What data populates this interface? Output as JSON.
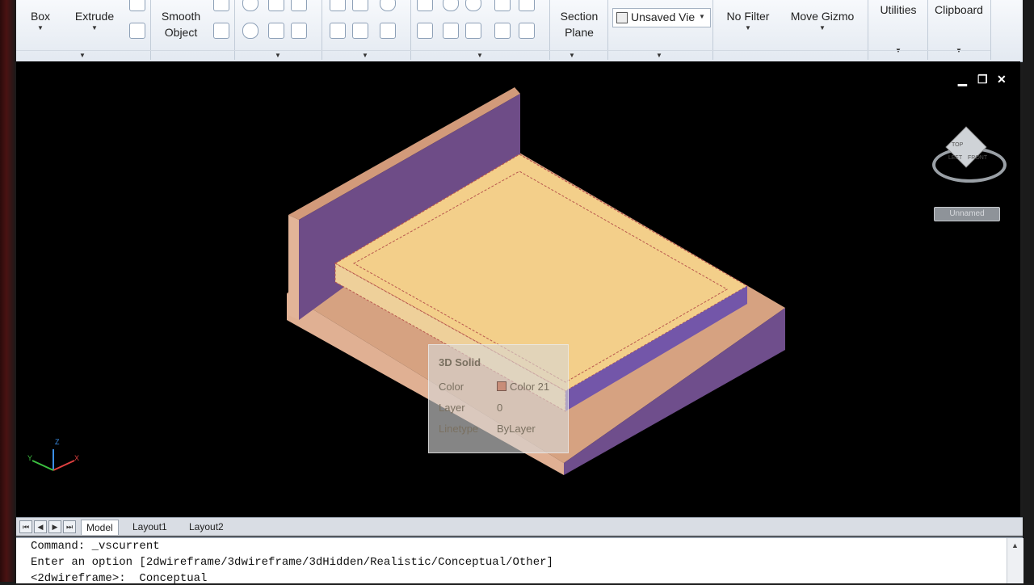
{
  "ribbon": {
    "box_label": "Box",
    "extrude_label": "Extrude",
    "smooth_object_label": "Smooth\nObject",
    "section_plane_label": "Section\nPlane",
    "view_select_value": "Unsaved Vie",
    "no_filter_label": "No Filter",
    "move_gizmo_label": "Move Gizmo",
    "utilities_label": "Utilities",
    "clipboard_label": "Clipboard"
  },
  "viewport": {
    "viewcube_faces": [
      "TOP",
      "LEFT",
      "FRONT"
    ],
    "view_name": "Unnamed",
    "axis_labels": {
      "x": "X",
      "y": "Y",
      "z": "Z"
    }
  },
  "tooltip": {
    "title": "3D Solid",
    "rows": [
      {
        "label": "Color",
        "value": "Color 21"
      },
      {
        "label": "Layer",
        "value": "0"
      },
      {
        "label": "Linetype",
        "value": "ByLayer"
      }
    ]
  },
  "tabs": [
    "Model",
    "Layout1",
    "Layout2"
  ],
  "command_lines": [
    "Command: _vscurrent",
    "Enter an option [2dwireframe/3dwireframe/3dHidden/Realistic/Conceptual/Other]",
    "<2dwireframe>:  Conceptual"
  ],
  "colors": {
    "headboard_face": "#6e4c87",
    "wood_top": "#d6a281",
    "mattress": "#f3cf8a",
    "accent_purple": "#7356a9",
    "swatch": "#c88d78"
  }
}
